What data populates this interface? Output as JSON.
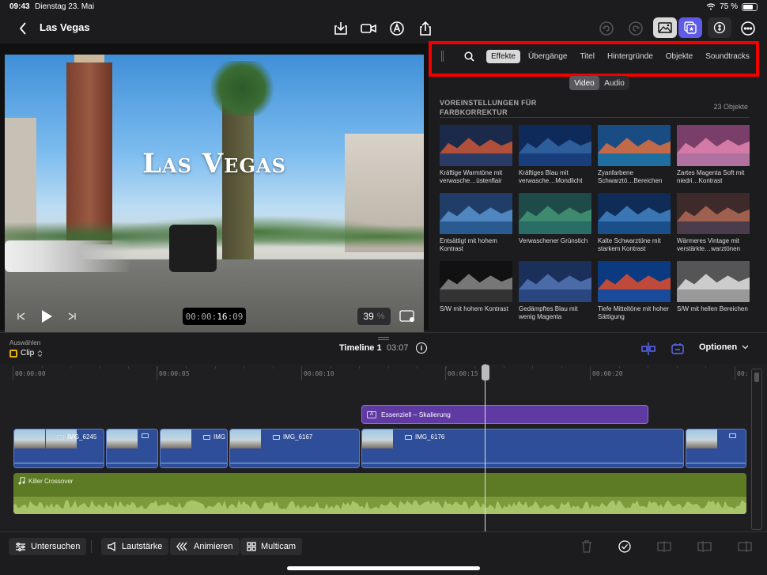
{
  "status": {
    "time": "09:43",
    "date": "Dienstag 23. Mai",
    "battery": "75 %",
    "battery_level": 0.75
  },
  "toolbar": {
    "project_title": "Las Vegas",
    "icons": [
      "back-icon",
      "import-icon",
      "camera-icon",
      "voiceover-icon",
      "share-icon",
      "undo-icon",
      "redo-icon",
      "photos-icon",
      "browser-icon",
      "inspector-icon",
      "more-icon"
    ],
    "accent": "#5e5ce6"
  },
  "viewer": {
    "video_title": "Las Vegas",
    "timecode_dim": "00:00:",
    "timecode_bright": "16",
    "timecode_frames": ":09",
    "zoom_value": "39",
    "zoom_unit": "%"
  },
  "browser": {
    "categories": [
      "Effekte",
      "Übergänge",
      "Titel",
      "Hintergründe",
      "Objekte",
      "Soundtracks"
    ],
    "active_category": "Effekte",
    "media_tabs": [
      "Video",
      "Audio"
    ],
    "active_media_tab": "Video",
    "section_title": "VOREINSTELLUNGEN FÜR FARBKORREKTUR",
    "section_count": "23 Objekte",
    "presets": [
      {
        "label": "Kräftige Warmtöne mit verwasche…üstenflair",
        "sky": "#1b2a4a",
        "mtn": "#b0503a",
        "water": "#2a3c66"
      },
      {
        "label": "Kräftiges Blau mit verwasche…Mondlicht",
        "sky": "#0d2a5a",
        "mtn": "#2d5d9a",
        "water": "#173e7a"
      },
      {
        "label": "Zyanfarbene Schwarztö…Bereichen",
        "sky": "#1a4c84",
        "mtn": "#c16a4a",
        "water": "#1e6ea0"
      },
      {
        "label": "Zartes Magenta Soft mit niedri…Kontrast",
        "sky": "#7a3e6a",
        "mtn": "#d47aa6",
        "water": "#b070a0"
      },
      {
        "label": "Entsättigt mit hohem Kontrast",
        "sky": "#1f3d66",
        "mtn": "#4f86c0",
        "water": "#2a5a90"
      },
      {
        "label": "Verwaschener Grünstich",
        "sky": "#1f4a4a",
        "mtn": "#3e8a6e",
        "water": "#2a6c66"
      },
      {
        "label": "Kalte Schwarztöne mit starkem Kontrast",
        "sky": "#0f2c56",
        "mtn": "#3a76b4",
        "water": "#1b4f8a"
      },
      {
        "label": "Wärmeres Vintage mit verstärkte…warztönen",
        "sky": "#3e2a2a",
        "mtn": "#a06050",
        "water": "#4a3c4a"
      },
      {
        "label": "S/W mit hohem Kontrast",
        "sky": "#111111",
        "mtn": "#777777",
        "water": "#333333"
      },
      {
        "label": "Gedämpftes Blau mit wenig Magenta",
        "sky": "#1a2f5a",
        "mtn": "#4a6aa8",
        "water": "#2a4680"
      },
      {
        "label": "Tiefe Mitteltöne mit hoher Sättigung",
        "sky": "#0c3a80",
        "mtn": "#c04a3a",
        "water": "#1a4a9a"
      },
      {
        "label": "S/W mit hellen Bereichen",
        "sky": "#555555",
        "mtn": "#cccccc",
        "water": "#999999"
      }
    ]
  },
  "timeline_header": {
    "select_label": "Auswählen",
    "select_value": "Clip",
    "title": "Timeline 1",
    "duration": "03:07",
    "info": "i",
    "options_label": "Optionen"
  },
  "timeline": {
    "ruler_labels": [
      "00:00:00",
      "00:00:05",
      "00:00:10",
      "00:00:15",
      "00:00:20",
      "00:"
    ],
    "title_clip": "Essenziell – Skalierung",
    "video_clips": [
      "IMG_6245",
      "",
      "IMG",
      "IMG_6167",
      "IMG_6176",
      ""
    ],
    "audio_clip": "Killer Crossover"
  },
  "bottombar": {
    "inspect": "Untersuchen",
    "volume": "Lautstärke",
    "animate": "Animieren",
    "multicam": "Multicam"
  }
}
